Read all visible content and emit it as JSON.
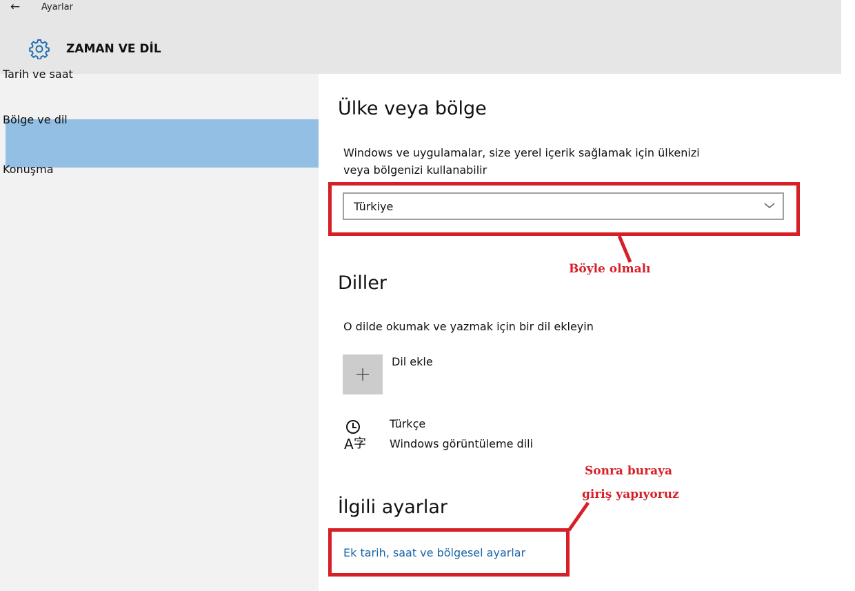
{
  "header": {
    "app_title": "Ayarlar",
    "section_title": "ZAMAN VE DİL"
  },
  "sidebar": {
    "items": [
      {
        "label": "Tarih ve saat",
        "selected": false
      },
      {
        "label": "Bölge ve dil",
        "selected": true
      },
      {
        "label": "Konuşma",
        "selected": false
      }
    ]
  },
  "main": {
    "region": {
      "heading": "Ülke veya bölge",
      "description_line1": "Windows ve uygulamalar, size yerel içerik sağlamak için ülkenizi",
      "description_line2": "veya bölgenizi kullanabilir",
      "selected_value": "Türkiye"
    },
    "languages": {
      "heading": "Diller",
      "description": "O dilde okumak ve yazmak için bir dil ekleyin",
      "add_label": "Dil ekle",
      "language_name": "Türkçe",
      "language_sub": "Windows görüntüleme dili"
    },
    "related": {
      "heading": "İlgili ayarlar",
      "link_label": "Ek tarih, saat ve bölgesel ayarlar"
    }
  },
  "annotations": {
    "note1": "Böyle olmalı",
    "note2_line1": "Sonra buraya",
    "note2_line2": "giriş yapıyoruz"
  },
  "colors": {
    "header_bg": "#e6e6e6",
    "sidebar_bg": "#f2f2f2",
    "selected_bg": "#94bfe4",
    "accent_blue": "#1a64a5",
    "annotation_red": "#d61f26"
  },
  "icons": {
    "back": "back-arrow-icon",
    "settings": "gear-icon",
    "dropdown": "chevron-down-icon",
    "add": "plus-icon",
    "language": "language-icon"
  }
}
